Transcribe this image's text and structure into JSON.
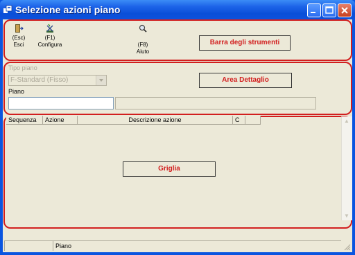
{
  "window": {
    "title": "Selezione azioni piano"
  },
  "toolbar": {
    "items": [
      {
        "shortcut": "(Esc)",
        "label": "Esci",
        "icon": "exit-door-icon"
      },
      {
        "shortcut": "(F1)",
        "label": "Configura",
        "icon": "configure-icon"
      },
      {
        "shortcut": "(F8)",
        "label": "Aiuto",
        "icon": "help-magnifier-icon"
      }
    ],
    "region_label": "Barra degli strumenti"
  },
  "detail": {
    "tipo_piano_label": "Tipo piano",
    "tipo_piano_value": "F-Standard (Fisso)",
    "piano_label": "Piano",
    "piano_value": "",
    "piano_description": "",
    "region_label": "Area Dettaglio"
  },
  "grid": {
    "columns": [
      "Sequenza",
      "Azione",
      "Descrizione azione",
      "C",
      ""
    ],
    "rows": [],
    "region_label": "Griglia"
  },
  "statusbar": {
    "cells": [
      "",
      "Piano",
      ""
    ]
  },
  "colors": {
    "accent": "#d21f1f",
    "titlebar": "#0a55e0",
    "face": "#ece9d8"
  }
}
